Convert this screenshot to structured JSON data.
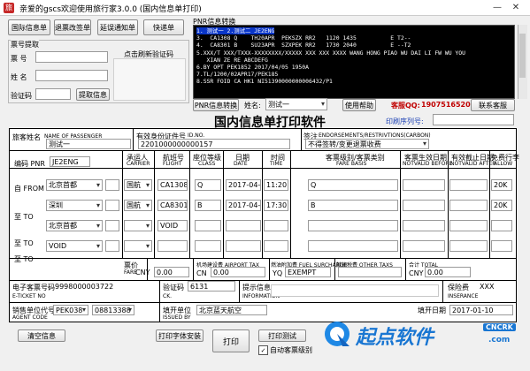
{
  "window": {
    "title": "亲爱的gscs欢迎使用旅行家3.0.0   (国内信息单打印)"
  },
  "buttons": {
    "intl_info": "国际信息单",
    "itin": "行程单",
    "ticket_check": "退票改签单",
    "delay_notice": "延误通知单",
    "quick_ticket": "快递单",
    "fetch_info": "提取信息",
    "pnr_convert": "PNR信息转换",
    "help": "使用帮助",
    "contact": "联系客服",
    "clear": "清空信息",
    "print_font": "打印字体安装",
    "print": "打印",
    "print_test": "打印测试"
  },
  "extract": {
    "legend": "票号提取",
    "ticket_label": "票 号",
    "name_label": "姓 名",
    "captcha_label": "验证码",
    "captcha_hint": "点击刷新验证码"
  },
  "pnr": {
    "legend": "PNR信息转换",
    "lines": [
      "1. 测试一 2.测试二 JE2ENG",
      "3.  CA1308 Q    TH20APR  PEKSZX RR2   1120 1435          E T2--",
      "4.  CA8301 B    SU23APR  SZXPEK RR2   1730 2040          E --T2",
      "5.XXX/T XXX/TXXX-XXXXXXXX/XXXXX XXX XXX XXXX WANG HONG PIAO WU DAI LI FW WU YOU",
      "   XIAN ZE RE ABCDEFG",
      "6.BY OPT PEK1852 2017/04/05 1950A",
      "7.TL/1200/02APR17/PEK185",
      "8.SSR FOID CA HK1 NI51390000000006432/P1"
    ],
    "name_label": "姓名:",
    "name_value": "测试一",
    "qq_label": "客服QQ:",
    "qq_value": "1907516520"
  },
  "form": {
    "title": "国内信息单打印软件",
    "serial_label": "印刷序列号:",
    "passenger_label": "旅客姓名",
    "passenger_en": "NAME OF PASSENGER",
    "passenger_value": "测试一",
    "id_label": "有效身份证件号",
    "id_en": "ID.NO.",
    "id_value": "2201000000000157",
    "endorse_label": "签注",
    "endorse_en": "ENDORSEMENTS/RESTRIVTIONS(CARBON)",
    "endorse_value": "不得签转/变更退票收费",
    "pnr_code_label": "编码 PNR",
    "pnr_code_value": "JE2ENG",
    "col_carrier": "承运人",
    "col_carrier_en": "CARRIER",
    "col_flight": "航班号",
    "col_flight_en": "FLIGHT",
    "col_class": "座位等级",
    "col_class_en": "CLASS",
    "col_date": "日期",
    "col_date_en": "DATE",
    "col_time": "时间",
    "col_time_en": "TIME",
    "col_fare_basis": "客票级别/客票类别",
    "col_fare_basis_en": "FARE BASIS",
    "col_nvb": "客票生效日期",
    "col_nvb_en": "NOTVALID BEFORE",
    "col_nva": "有效截止日期",
    "col_nva_en": "NOTVALID AFTER",
    "col_allow": "免费行李",
    "col_allow_en": "ALLOW",
    "from_label": "自 FROM",
    "to_label": "至 TO",
    "segments": [
      {
        "city": "北京首都",
        "carrier": "国航",
        "flight": "CA1308",
        "class": "Q",
        "date": "2017-04-20",
        "time": "11:20",
        "fare": "Q",
        "allow": "20K"
      },
      {
        "city": "深圳",
        "carrier": "国航",
        "flight": "CA8301",
        "class": "B",
        "date": "2017-04-23",
        "time": "17:30",
        "fare": "B",
        "allow": "20K"
      },
      {
        "city": "北京首都",
        "carrier": "",
        "flight": "VOID",
        "class": "",
        "date": "",
        "time": "",
        "fare": "",
        "allow": ""
      },
      {
        "city": "VOID",
        "carrier": "",
        "flight": "",
        "class": "",
        "date": "",
        "time": "",
        "fare": "",
        "allow": ""
      }
    ],
    "fare_label": "票价",
    "fare_en": "FARE",
    "fare_cur": "CNY",
    "fare_value": "0.00",
    "airport_tax_label": "机场建设费 AIRPORT TAX",
    "airport_tax_cur": "CN",
    "airport_tax_value": "0.00",
    "fuel_label": "燃油附加费 FUEL SURCHARGE",
    "fuel_cur": "YQ",
    "fuel_value": "EXEMPT",
    "other_tax_label": "其他税费 OTHER TAXS",
    "total_label": "合计 TOTAL",
    "total_cur": "CNY",
    "total_value": "0.00",
    "eticket_label": "电子客票号码",
    "eticket_en": "E-TICKET NO",
    "eticket_value": "9998000003722",
    "ck_label": "验证码",
    "ck_en": "CK.",
    "ck_value": "6131",
    "info_label": "提示信息",
    "info_en": "INFORMATION",
    "insurance_label": "保险费",
    "insurance_en": "INSERANCE",
    "insurance_value": "XXX",
    "agent_label": "销售单位代号",
    "agent_en": "AGENT CODE",
    "agent_value": "PEK038",
    "agent_value2": "08813388",
    "issued_label": "填开单位",
    "issued_en": "ISSUED BY",
    "issued_value": "北京蓝天航空",
    "issue_date_label": "填开日期",
    "issue_date_value": "2017-01-10",
    "auto_label": "自动客票级别"
  },
  "watermark": {
    "text": "起点软件",
    "sub": "CNCRK",
    "tld": ".com"
  }
}
